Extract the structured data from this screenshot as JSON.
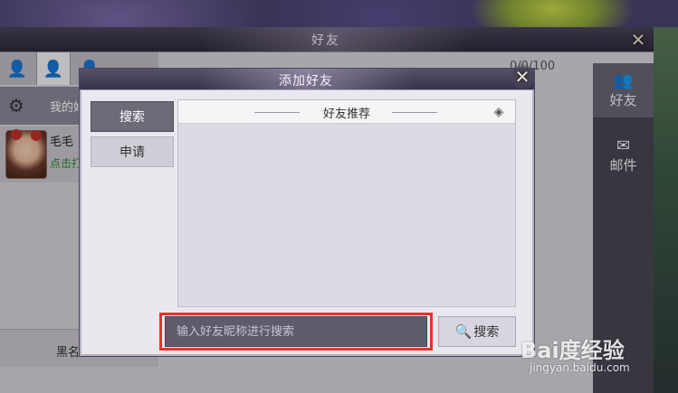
{
  "friend_panel": {
    "title": "好友",
    "close_icon": "close-icon",
    "tabs": [
      {
        "icon": "friend-online-icon"
      },
      {
        "icon": "friend-icon"
      },
      {
        "icon": "friend-add-icon"
      }
    ],
    "my_row_label": "我的好",
    "friend": {
      "name": "毛毛",
      "sub": "点击打"
    },
    "blacklist_label": "黑名",
    "count": "0/0/100"
  },
  "right_sidebar": {
    "items": [
      {
        "label": "好友",
        "icon": "friends-icon"
      },
      {
        "label": "邮件",
        "icon": "mail-icon"
      }
    ]
  },
  "dialog": {
    "title": "添加好友",
    "tabs": [
      {
        "label": "搜索"
      },
      {
        "label": "申请"
      }
    ],
    "recommend_title": "好友推荐",
    "search_placeholder": "输入好友昵称进行搜索",
    "search_button": "搜索"
  },
  "watermark": {
    "logo": "Bai度经验",
    "url": "jingyan.baidu.com"
  },
  "colors": {
    "highlight": "#e8332e",
    "active_tab": "#6e6a78"
  }
}
